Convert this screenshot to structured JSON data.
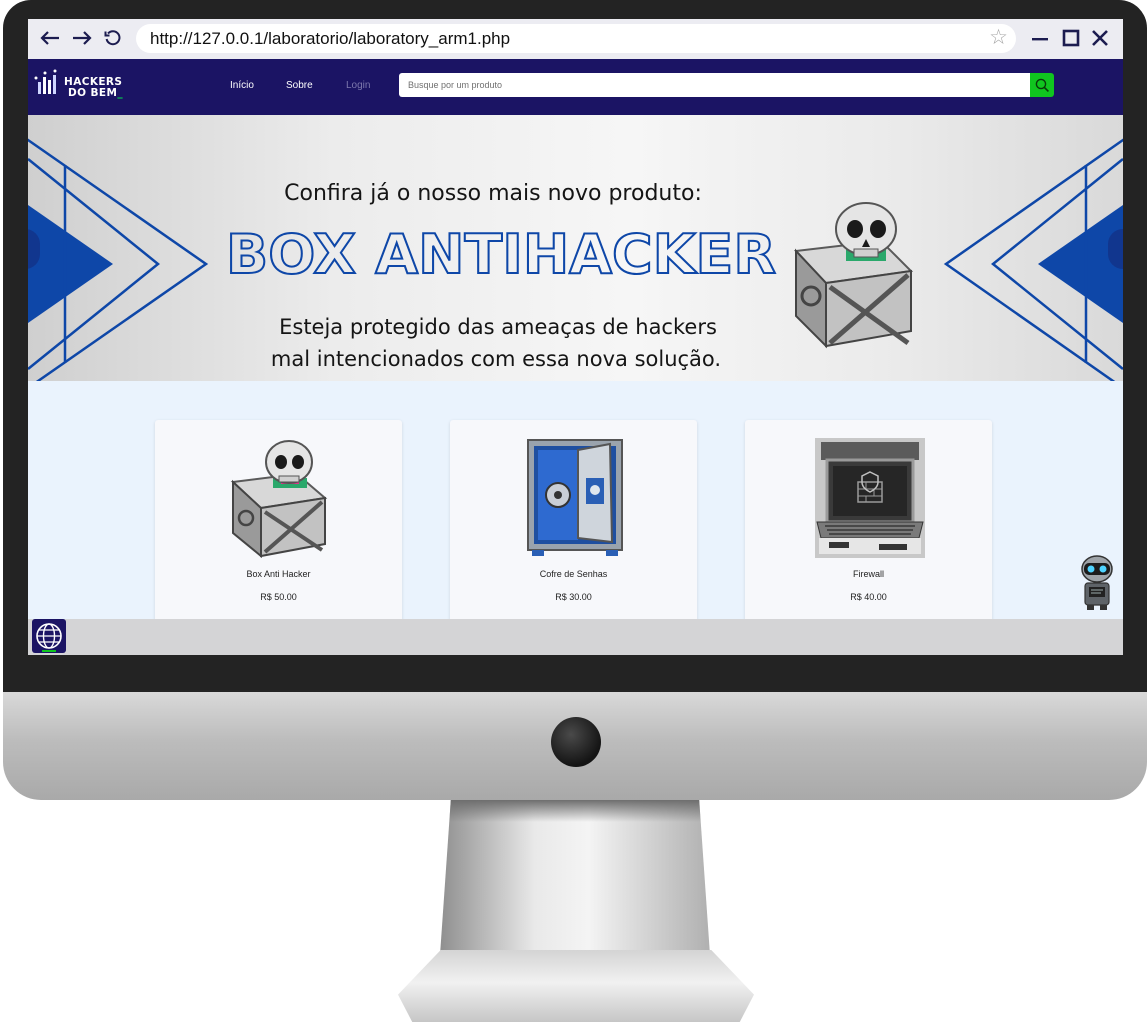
{
  "browser": {
    "url": "http://127.0.0.1/laboratorio/laboratory_arm1.php",
    "icons": [
      "back-arrow-icon",
      "forward-arrow-icon",
      "reload-icon",
      "bookmark-star-icon",
      "minimize-icon",
      "maximize-icon",
      "close-icon"
    ]
  },
  "site": {
    "logo_line1": "HACKERS",
    "logo_line2": "DO BEM",
    "logo_underscore": "_",
    "nav": [
      "Início",
      "Sobre",
      "Login"
    ],
    "search_placeholder": "Busque por um produto"
  },
  "banner": {
    "heading": "Confira já o nosso mais novo produto:",
    "title": "BOX ANTIHACKER",
    "line1": "Esteja protegido das ameaças de hackers",
    "line2": "mal intencionados com essa nova solução."
  },
  "products": [
    {
      "name": "Box Anti Hacker",
      "price": "R$ 50.00",
      "image": "skull-box-image"
    },
    {
      "name": "Cofre de Senhas",
      "price": "R$ 30.00",
      "image": "safe-image"
    },
    {
      "name": "Firewall",
      "price": "R$ 40.00",
      "image": "laptop-firewall-image"
    }
  ],
  "colors": {
    "header": "#1b1464",
    "search_button": "#10c51f",
    "banner_blue": "#0e47a8",
    "page_bg": "#eaf3fd"
  }
}
